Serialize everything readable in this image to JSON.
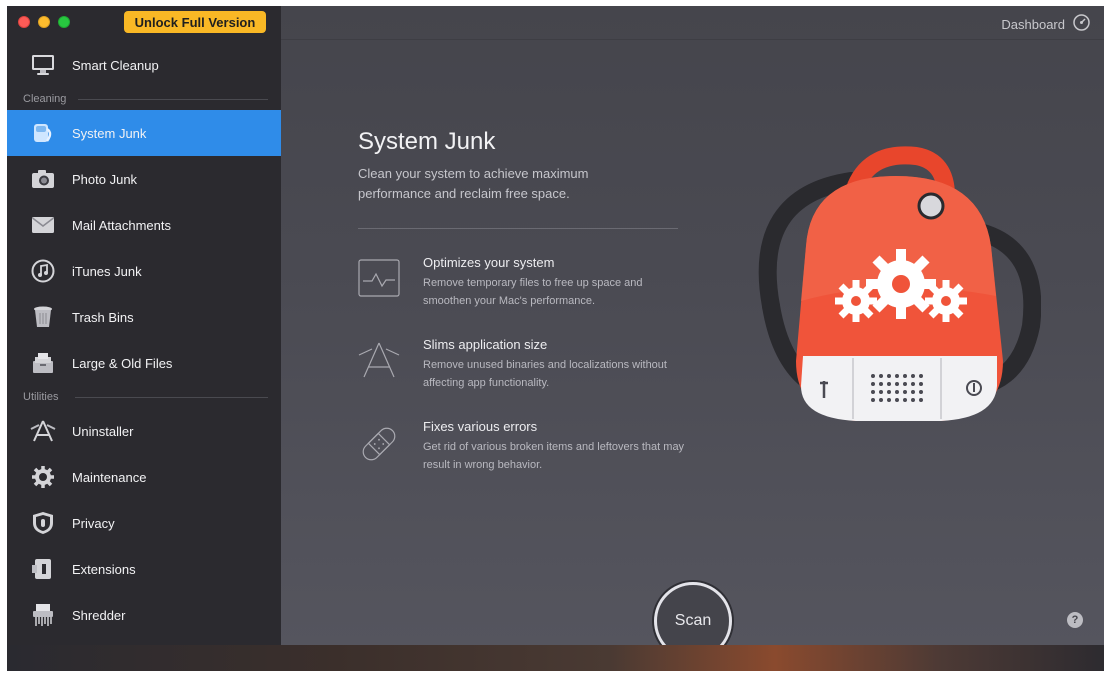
{
  "window": {
    "unlock_label": "Unlock Full Version"
  },
  "sidebar": {
    "top_item": {
      "label": "Smart Cleanup",
      "icon": "monitor-icon"
    },
    "sections": [
      {
        "label": "Cleaning"
      },
      {
        "label": "Utilities"
      }
    ],
    "cleaning_items": [
      {
        "label": "System Junk",
        "icon": "disk-cleaner-icon",
        "active": true
      },
      {
        "label": "Photo Junk",
        "icon": "camera-icon"
      },
      {
        "label": "Mail Attachments",
        "icon": "envelope-icon"
      },
      {
        "label": "iTunes Junk",
        "icon": "music-note-icon"
      },
      {
        "label": "Trash Bins",
        "icon": "trash-icon"
      },
      {
        "label": "Large & Old Files",
        "icon": "file-stack-icon"
      }
    ],
    "utility_items": [
      {
        "label": "Uninstaller",
        "icon": "app-wrench-icon"
      },
      {
        "label": "Maintenance",
        "icon": "gear-icon"
      },
      {
        "label": "Privacy",
        "icon": "shield-hand-icon"
      },
      {
        "label": "Extensions",
        "icon": "extension-icon"
      },
      {
        "label": "Shredder",
        "icon": "shredder-icon"
      }
    ],
    "active_color": "#2f8ce9"
  },
  "header": {
    "dashboard_label": "Dashboard"
  },
  "main": {
    "title": "System Junk",
    "subtitle": "Clean your system to achieve maximum performance and reclaim free space.",
    "features": [
      {
        "title": "Optimizes your system",
        "description": "Remove temporary files to free up space and smoothen your Mac's performance.",
        "icon": "pulse-monitor-icon"
      },
      {
        "title": "Slims application size",
        "description": "Remove unused binaries and localizations without affecting app functionality.",
        "icon": "app-store-icon"
      },
      {
        "title": "Fixes various errors",
        "description": "Get rid of various broken items and leftovers that may result in wrong behavior.",
        "icon": "bandage-icon"
      }
    ],
    "scan_label": "Scan",
    "help_label": "?"
  }
}
